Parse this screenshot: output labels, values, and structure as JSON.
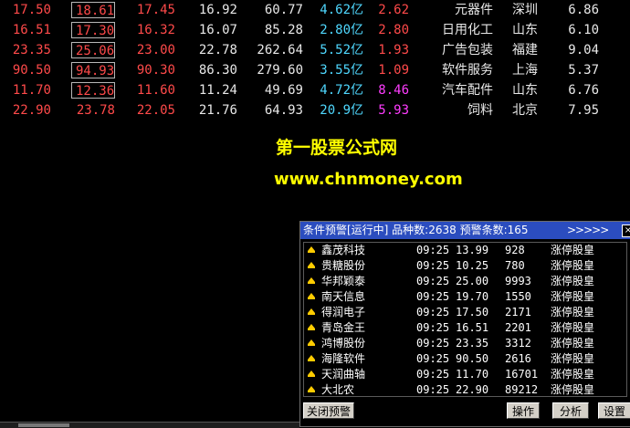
{
  "quotes": [
    {
      "c0": "17.50",
      "c1": "18.61",
      "c2": "17.45",
      "c3": "16.92",
      "c4": "60.77",
      "c5": "4.62亿",
      "c6": "2.62",
      "c7": "元器件",
      "c8": "深圳",
      "c9": "6.86"
    },
    {
      "c0": "16.51",
      "c1": "17.30",
      "c2": "16.32",
      "c3": "16.07",
      "c4": "85.28",
      "c5": "2.80亿",
      "c6": "2.80",
      "c7": "日用化工",
      "c8": "山东",
      "c9": "6.10"
    },
    {
      "c0": "23.35",
      "c1": "25.06",
      "c2": "23.00",
      "c3": "22.78",
      "c4": "262.64",
      "c5": "5.52亿",
      "c6": "1.93",
      "c7": "广告包装",
      "c8": "福建",
      "c9": "9.04"
    },
    {
      "c0": "90.50",
      "c1": "94.93",
      "c2": "90.30",
      "c3": "86.30",
      "c4": "279.60",
      "c5": "3.55亿",
      "c6": "1.09",
      "c7": "软件服务",
      "c8": "上海",
      "c9": "5.37"
    },
    {
      "c0": "11.70",
      "c1": "12.36",
      "c2": "11.60",
      "c3": "11.24",
      "c4": "49.69",
      "c5": "4.72亿",
      "c6": "8.46",
      "c7": "汽车配件",
      "c8": "山东",
      "c9": "6.76"
    },
    {
      "c0": "22.90",
      "c1": "23.78",
      "c2": "22.05",
      "c3": "21.76",
      "c4": "64.93",
      "c5": "20.9亿",
      "c6": "5.93",
      "c7": "饲料",
      "c8": "北京",
      "c9": "7.95"
    }
  ],
  "colors": {
    "up": "#ff4a4a",
    "flat": "#e8e8e8",
    "amount": "#4fd8ff",
    "ratio_high": "#ff3cff",
    "promo": "#ffff00",
    "titlebar": "#2b4dbf"
  },
  "promo": {
    "title": "第一股票公式网",
    "url": "www.chnmoney.com"
  },
  "alert": {
    "title": "条件预警[运行中] 品种数:2638 预警条数:165",
    "arrows": ">>>>>",
    "close_glyph": "×",
    "rows": [
      {
        "name": "鑫茂科技",
        "time": "09:25",
        "price": "13.99",
        "volume": "928",
        "type": "涨停股皇"
      },
      {
        "name": "贵糖股份",
        "time": "09:25",
        "price": "10.25",
        "volume": "780",
        "type": "涨停股皇"
      },
      {
        "name": "华邦颖泰",
        "time": "09:25",
        "price": "25.00",
        "volume": "9993",
        "type": "涨停股皇"
      },
      {
        "name": "南天信息",
        "time": "09:25",
        "price": "19.70",
        "volume": "1550",
        "type": "涨停股皇"
      },
      {
        "name": "得润电子",
        "time": "09:25",
        "price": "17.50",
        "volume": "2171",
        "type": "涨停股皇"
      },
      {
        "name": "青岛金王",
        "time": "09:25",
        "price": "16.51",
        "volume": "2201",
        "type": "涨停股皇"
      },
      {
        "name": "鸿博股份",
        "time": "09:25",
        "price": "23.35",
        "volume": "3312",
        "type": "涨停股皇"
      },
      {
        "name": "海隆软件",
        "time": "09:25",
        "price": "90.50",
        "volume": "2616",
        "type": "涨停股皇"
      },
      {
        "name": "天润曲轴",
        "time": "09:25",
        "price": "11.70",
        "volume": "16701",
        "type": "涨停股皇"
      },
      {
        "name": "大北农",
        "time": "09:25",
        "price": "22.90",
        "volume": "89212",
        "type": "涨停股皇"
      }
    ],
    "buttons": {
      "close_alert": "关闭预警",
      "operate": "操作",
      "analyze": "分析",
      "settings": "设置"
    }
  }
}
